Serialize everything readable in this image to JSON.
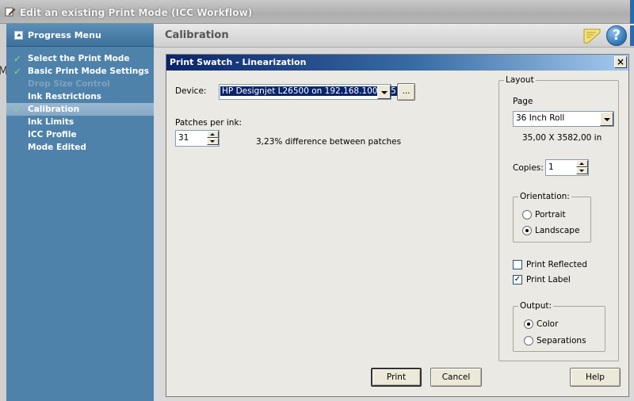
{
  "window": {
    "title": "Edit an existing Print Mode (ICC Workflow)"
  },
  "left_edge": {
    "char": "M"
  },
  "progress_menu": {
    "title": "Progress Menu",
    "steps": [
      {
        "label": "Select the Print Mode",
        "state": "done"
      },
      {
        "label": "Basic Print Mode Settings",
        "state": "done"
      },
      {
        "label": "Drop Size Control",
        "state": "disabled"
      },
      {
        "label": "Ink Restrictions",
        "state": "normal"
      },
      {
        "label": "Calibration",
        "state": "current"
      },
      {
        "label": "Ink Limits",
        "state": "normal"
      },
      {
        "label": "ICC Profile",
        "state": "normal"
      },
      {
        "label": "Mode Edited",
        "state": "normal"
      }
    ],
    "check_mark": "✓"
  },
  "header": {
    "title": "Calibration",
    "help_glyph": "?"
  },
  "dialog": {
    "title": "Print Swatch - Linearization",
    "close_glyph": "×",
    "device_label": "Device:",
    "device_value": "HP Designjet L26500 on 192.168.100.185",
    "browse_label": "...",
    "patches_label": "Patches per ink:",
    "patches_value": "31",
    "difference_text": "3,23% difference between patches",
    "layout": {
      "legend": "Layout",
      "page_label": "Page",
      "page_value": "36 Inch Roll",
      "dimensions": "35,00 X 3582,00  in",
      "copies_label": "Copies:",
      "copies_value": "1",
      "orientation_legend": "Orientation:",
      "portrait_label": "Portrait",
      "landscape_label": "Landscape",
      "orientation_selected": "Landscape",
      "print_reflected_label": "Print Reflected",
      "print_reflected_checked": false,
      "print_label_label": "Print Label",
      "print_label_checked": true,
      "output_legend": "Output:",
      "color_label": "Color",
      "separations_label": "Separations",
      "output_selected": "Color"
    },
    "buttons": {
      "print": "Print",
      "cancel": "Cancel",
      "help": "Help"
    }
  },
  "colors": {
    "panel": "#4e82aa",
    "dialog_title": "#0a246a",
    "check": "#7ee07e"
  }
}
